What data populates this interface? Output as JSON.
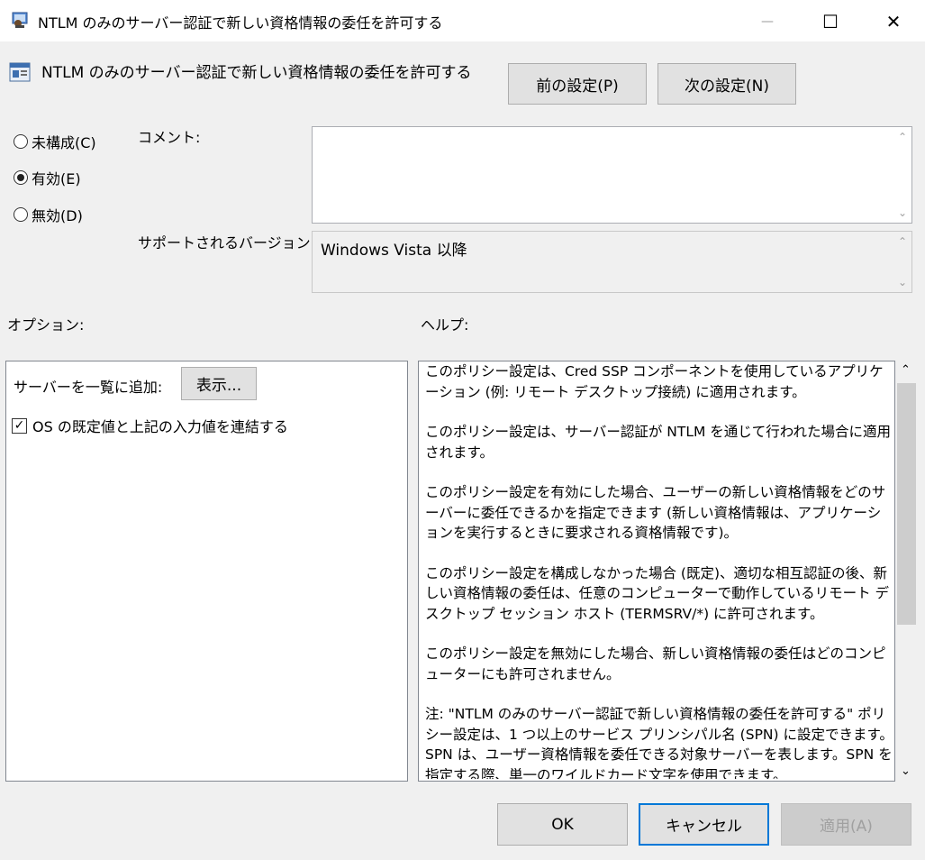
{
  "window": {
    "title": "NTLM のみのサーバー認証で新しい資格情報の委任を許可する",
    "minimize_glyph": "—",
    "maximize_glyph": "☐",
    "close_glyph": "✕"
  },
  "header": {
    "policy_title": "NTLM のみのサーバー認証で新しい資格情報の委任を許可する",
    "prev_label": "前の設定(P)",
    "next_label": "次の設定(N)"
  },
  "state": {
    "options": [
      {
        "label": "未構成(C)",
        "selected": false
      },
      {
        "label": "有効(E)",
        "selected": true
      },
      {
        "label": "無効(D)",
        "selected": false
      }
    ]
  },
  "comment": {
    "label": "コメント:",
    "value": ""
  },
  "supported": {
    "label": "サポートされるバージョン:",
    "value": "Windows Vista 以降"
  },
  "options_pane": {
    "heading": "オプション:",
    "server_list_label": "サーバーを一覧に追加:",
    "show_button": "表示...",
    "concatenate_label": "OS の既定値と上記の入力値を連結する",
    "concatenate_checked": true
  },
  "help_pane": {
    "heading": "ヘルプ:",
    "paragraphs": [
      "このポリシー設定は、Cred SSP コンポーネントを使用しているアプリケーション (例: リモート デスクトップ接続) に適用されます。",
      "このポリシー設定は、サーバー認証が NTLM を通じて行われた場合に適用されます。",
      "このポリシー設定を有効にした場合、ユーザーの新しい資格情報をどのサーバーに委任できるかを指定できます (新しい資格情報は、アプリケーションを実行するときに要求される資格情報です)。",
      "このポリシー設定を構成しなかった場合 (既定)、適切な相互認証の後、新しい資格情報の委任は、任意のコンピューターで動作しているリモート デスクトップ セッション ホスト (TERMSRV/*) に許可されます。",
      "このポリシー設定を無効にした場合、新しい資格情報の委任はどのコンピューターにも許可されません。",
      "注: \"NTLM のみのサーバー認証で新しい資格情報の委任を許可する\" ポリシー設定は、1 つ以上のサービス プリンシパル名 (SPN) に設定できます。SPN は、ユーザー資格情報を委任できる対象サーバーを表します。SPN を指定する際、単一のワイルドカード文字を使用できます。"
    ]
  },
  "footer": {
    "ok_label": "OK",
    "cancel_label": "キャンセル",
    "apply_label": "適用(A)"
  },
  "icons": {
    "scroll_up": "⌃",
    "scroll_down": "⌄",
    "check": "✓"
  }
}
